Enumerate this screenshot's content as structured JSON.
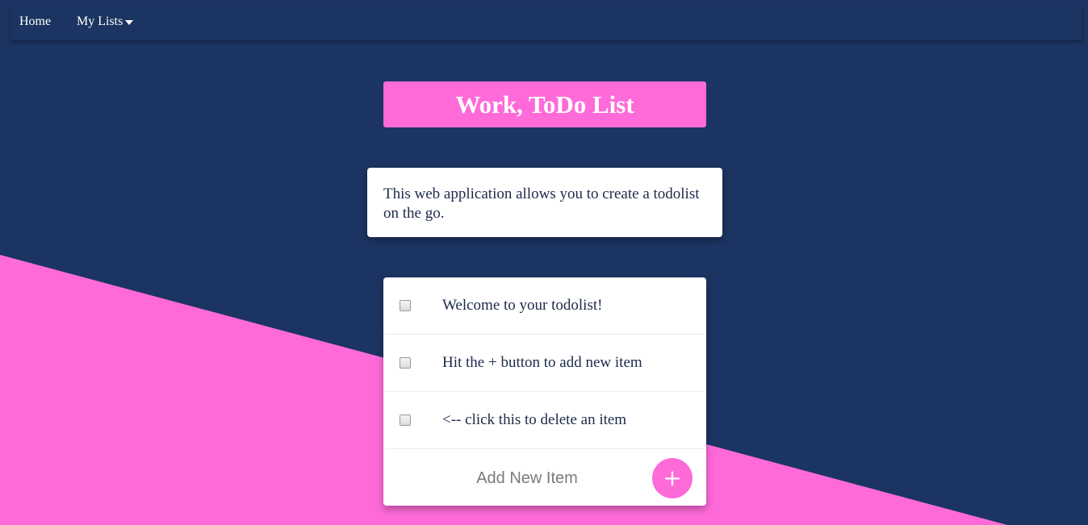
{
  "theme": {
    "background": "#1c3461",
    "accent": "#ff6ad9",
    "card": "#ffffff"
  },
  "nav": {
    "home_label": "Home",
    "lists_label": "My Lists",
    "lists_icon": "caret-down-icon"
  },
  "header": {
    "title": "Work, ToDo List"
  },
  "intro": {
    "text": "This web application allows you to create a todolist on the go."
  },
  "todo": {
    "items": [
      {
        "label": "Welcome to your todolist!",
        "checked": false
      },
      {
        "label": "Hit the + button to add new item",
        "checked": false
      },
      {
        "label": "<-- click this to delete an item",
        "checked": false
      }
    ],
    "new_item_placeholder": "Add New Item",
    "add_button_label": "+"
  }
}
